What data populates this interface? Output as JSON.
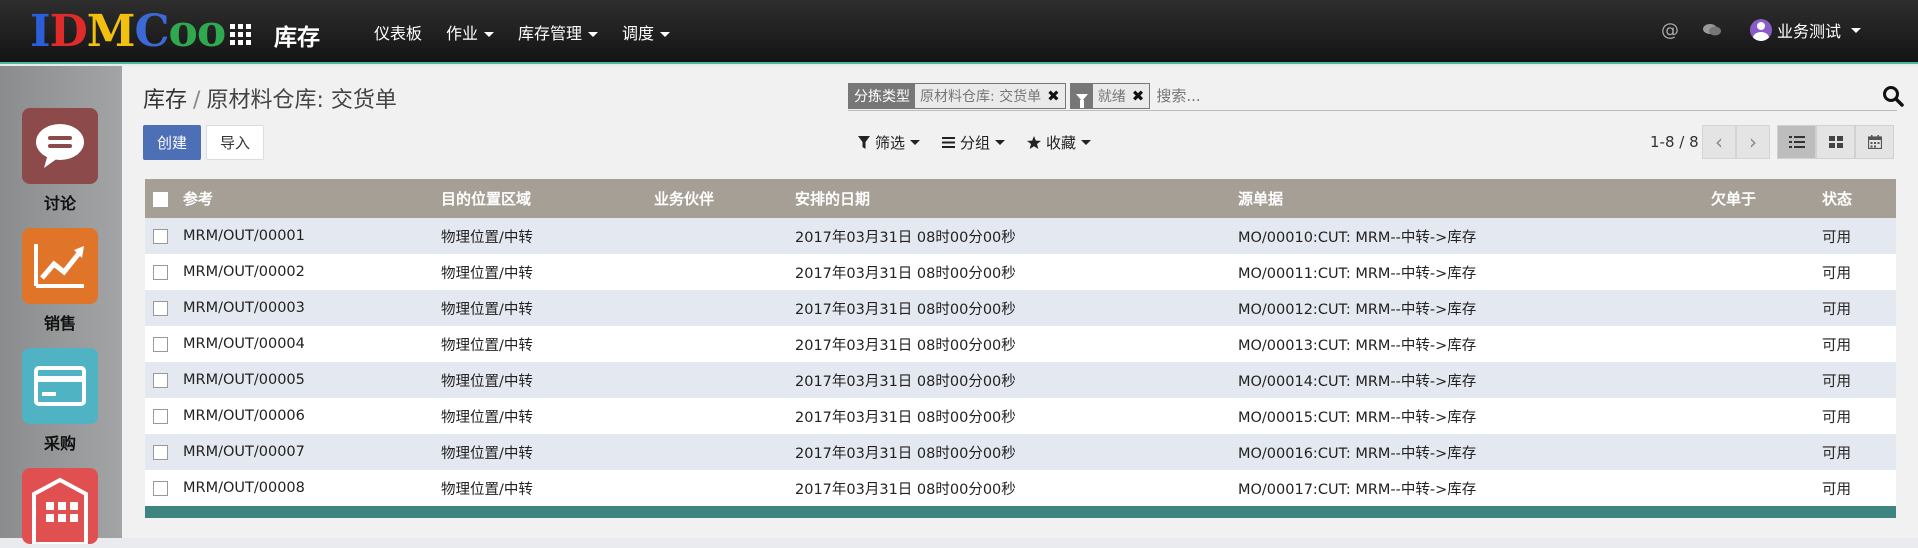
{
  "logo": {
    "letters": [
      "I",
      "D",
      "M",
      "C",
      "o",
      "o"
    ],
    "colors": [
      "#2b5fd9",
      "#e02b2b",
      "#f2c10f",
      "#3b6ad8",
      "#2fa84f",
      "#2fa84f"
    ]
  },
  "app_title": "库存",
  "top_menu": [
    {
      "label": "仪表板",
      "dropdown": false
    },
    {
      "label": "作业",
      "dropdown": true
    },
    {
      "label": "库存管理",
      "dropdown": true
    },
    {
      "label": "调度",
      "dropdown": true
    }
  ],
  "user": {
    "name": "业务测试"
  },
  "icons": {
    "at": "@"
  },
  "sidebar": {
    "items": [
      {
        "label": "讨论",
        "icon": "chat-bubble-icon",
        "color": "#8c4a4a"
      },
      {
        "label": "销售",
        "icon": "trend-chart-icon",
        "color": "#e07428"
      },
      {
        "label": "采购",
        "icon": "credit-card-icon",
        "color": "#4fb3c4"
      },
      {
        "label": "",
        "icon": "warehouse-icon",
        "color": "#e05050"
      }
    ]
  },
  "breadcrumb": {
    "parent": "库存",
    "separator": "/",
    "current": "原材料仓库: 交货单"
  },
  "buttons": {
    "create": "创建",
    "import": "导入"
  },
  "search": {
    "facets": [
      {
        "key": "分拣类型",
        "value": "原材料仓库: 交货单",
        "icon": ""
      },
      {
        "key": "",
        "value": "就绪",
        "icon": "filter-icon"
      }
    ],
    "placeholder": "搜索...",
    "remove": "✖"
  },
  "filters": {
    "filter": "筛选",
    "group": "分组",
    "favorite": "收藏"
  },
  "pager": {
    "text": "1-8 / 8",
    "prev": "‹",
    "next": "›"
  },
  "table": {
    "columns": [
      "参考",
      "目的位置区域",
      "业务伙伴",
      "安排的日期",
      "源单据",
      "欠单于",
      "状态"
    ],
    "rows": [
      {
        "ref": "MRM/OUT/00001",
        "dest": "物理位置/中转",
        "partner": "",
        "date": "2017年03月31日 08时00分00秒",
        "source": "MO/00010:CUT: MRM--中转->库存",
        "backorder": "",
        "state": "可用"
      },
      {
        "ref": "MRM/OUT/00002",
        "dest": "物理位置/中转",
        "partner": "",
        "date": "2017年03月31日 08时00分00秒",
        "source": "MO/00011:CUT: MRM--中转->库存",
        "backorder": "",
        "state": "可用"
      },
      {
        "ref": "MRM/OUT/00003",
        "dest": "物理位置/中转",
        "partner": "",
        "date": "2017年03月31日 08时00分00秒",
        "source": "MO/00012:CUT: MRM--中转->库存",
        "backorder": "",
        "state": "可用"
      },
      {
        "ref": "MRM/OUT/00004",
        "dest": "物理位置/中转",
        "partner": "",
        "date": "2017年03月31日 08时00分00秒",
        "source": "MO/00013:CUT: MRM--中转->库存",
        "backorder": "",
        "state": "可用"
      },
      {
        "ref": "MRM/OUT/00005",
        "dest": "物理位置/中转",
        "partner": "",
        "date": "2017年03月31日 08时00分00秒",
        "source": "MO/00014:CUT: MRM--中转->库存",
        "backorder": "",
        "state": "可用"
      },
      {
        "ref": "MRM/OUT/00006",
        "dest": "物理位置/中转",
        "partner": "",
        "date": "2017年03月31日 08时00分00秒",
        "source": "MO/00015:CUT: MRM--中转->库存",
        "backorder": "",
        "state": "可用"
      },
      {
        "ref": "MRM/OUT/00007",
        "dest": "物理位置/中转",
        "partner": "",
        "date": "2017年03月31日 08时00分00秒",
        "source": "MO/00016:CUT: MRM--中转->库存",
        "backorder": "",
        "state": "可用"
      },
      {
        "ref": "MRM/OUT/00008",
        "dest": "物理位置/中转",
        "partner": "",
        "date": "2017年03月31日 08时00分00秒",
        "source": "MO/00017:CUT: MRM--中转->库存",
        "backorder": "",
        "state": "可用"
      }
    ]
  },
  "colors": {
    "accent": "#4c6fb6",
    "header": "#a59f95",
    "footer": "#3e8582",
    "row_alt": "#e4e8f0"
  }
}
